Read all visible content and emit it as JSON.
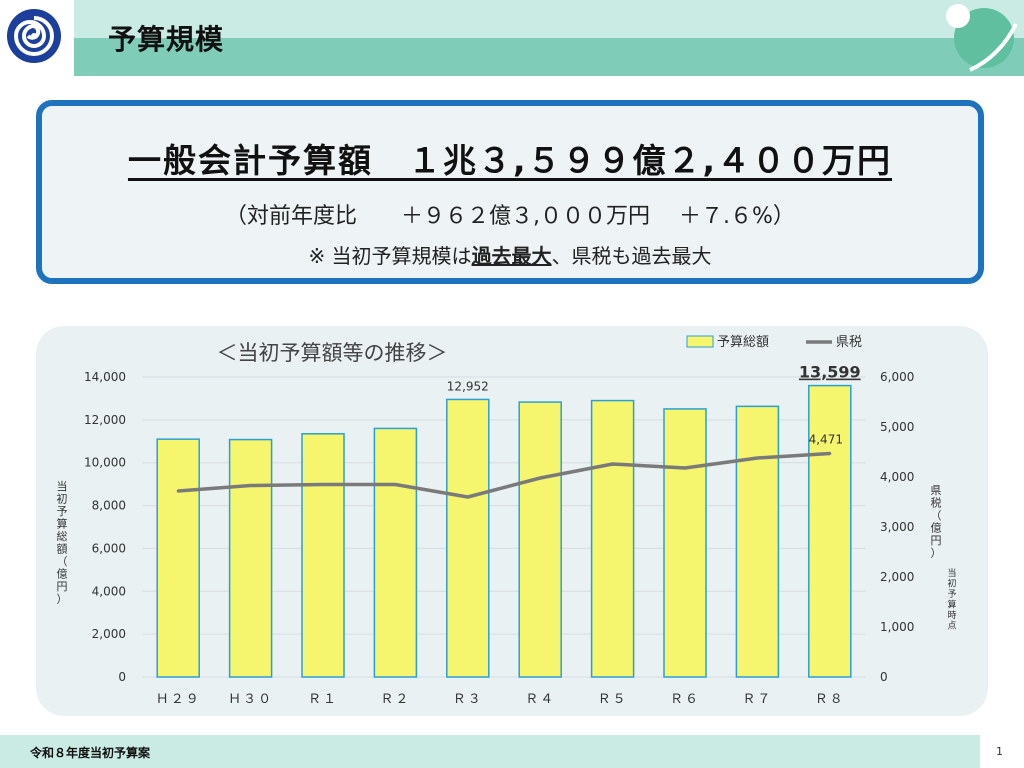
{
  "header": {
    "title": "予算規模"
  },
  "summary": {
    "headline": "一般会計予算額　１兆３,５９９億２,４００万円",
    "subline": "（対前年度比　　＋９６２億３,０００万円　 ＋７.６%）",
    "note_prefix": "※ 当初予算規模は",
    "note_emphasis": "過去最大",
    "note_suffix": "、県税も過去最大"
  },
  "chart_data": {
    "type": "bar",
    "title": "＜当初予算額等の推移＞",
    "categories": [
      "Ｈ２９",
      "Ｈ３０",
      "Ｒ１",
      "Ｒ２",
      "Ｒ３",
      "Ｒ４",
      "Ｒ５",
      "Ｒ６",
      "Ｒ７",
      "Ｒ８"
    ],
    "series": [
      {
        "name": "予算総額",
        "type": "bar",
        "axis": "left",
        "color": "#f5f56e",
        "values": [
          11100,
          11080,
          11350,
          11600,
          12952,
          12830,
          12900,
          12510,
          12630,
          13599
        ]
      },
      {
        "name": "県税",
        "type": "line",
        "axis": "right",
        "color": "#7a7a7a",
        "values": [
          3720,
          3830,
          3850,
          3850,
          3600,
          3980,
          4260,
          4180,
          4380,
          4471
        ]
      }
    ],
    "ylabel_left": "当初予算総額（億円）",
    "ylabel_right": "県税（億円）",
    "ylabel_right_note": "当初予算時点",
    "ylim_left": [
      0,
      14000
    ],
    "yticks_left": [
      "0",
      "2,000",
      "4,000",
      "6,000",
      "8,000",
      "10,000",
      "12,000",
      "14,000"
    ],
    "ylim_right": [
      0,
      6000
    ],
    "yticks_right": [
      "0",
      "1,000",
      "2,000",
      "3,000",
      "4,000",
      "5,000",
      "6,000"
    ],
    "annotations": [
      {
        "category": "Ｒ３",
        "series": "予算総額",
        "text": "12,952"
      },
      {
        "category": "Ｒ８",
        "series": "予算総額",
        "text": "13,599"
      },
      {
        "category": "Ｒ８",
        "series": "県税",
        "text": "4,471"
      }
    ],
    "grid": true,
    "legend": "top-right"
  },
  "footer": {
    "text": "令和８年度当初予算案",
    "page_number": "1"
  },
  "colors": {
    "box_border": "#1e73be",
    "header_dark": "#7fcdb8",
    "header_light": "#c9ebe3",
    "bar_fill": "#f5f56e",
    "bar_edge": "#2a9fd6",
    "line": "#7a7a7a"
  },
  "icons": {
    "logo": "prefecture-logo-icon"
  }
}
